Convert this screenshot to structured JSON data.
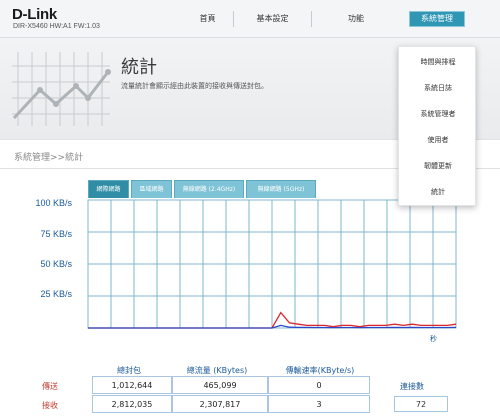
{
  "header": {
    "brand": "D-Link",
    "model": "DIR-X5460 HW:A1 FW:1.03",
    "nav": [
      {
        "label": "首頁"
      },
      {
        "label": "基本設定"
      },
      {
        "label": "功能"
      },
      {
        "label": "系統管理"
      }
    ]
  },
  "banner": {
    "title": "統計",
    "description": "流量統計會顯示經由此裝置的接收與傳送封包。"
  },
  "breadcrumb": "系統管理>>統計",
  "dropdown": {
    "items": [
      {
        "label": "時間與排程"
      },
      {
        "label": "系統日誌"
      },
      {
        "label": "系統管理者"
      },
      {
        "label": "使用者"
      },
      {
        "label": "韌體更新"
      },
      {
        "label": "統計"
      }
    ]
  },
  "tabs": [
    {
      "label": "網際網路"
    },
    {
      "label": "區域網路"
    },
    {
      "label": "無線網路 (2.4GHz)"
    },
    {
      "label": "無線網路 (5GHz)"
    }
  ],
  "chart_data": {
    "type": "line",
    "y_ticks": [
      "100 KB/s",
      "75 KB/s",
      "50 KB/s",
      "25 KB/s"
    ],
    "ylim": [
      0,
      100
    ],
    "x_unit": "秒",
    "grid": true,
    "series": [
      {
        "color": "#d9252b",
        "values": [
          0,
          0,
          0,
          0,
          0,
          0,
          0,
          0,
          0,
          0,
          0,
          0,
          0,
          0,
          0,
          0,
          0,
          0,
          0,
          0,
          0,
          0,
          12,
          4,
          3,
          2,
          2,
          2,
          1,
          2,
          2,
          1,
          2,
          2,
          2,
          3,
          2,
          3,
          2,
          2,
          2,
          2,
          3
        ]
      },
      {
        "color": "#2b48c8",
        "values": [
          0,
          0,
          0,
          0,
          0,
          0,
          0,
          0,
          0,
          0,
          0,
          0,
          0,
          0,
          0,
          0,
          0,
          0,
          0,
          0,
          0,
          0,
          2,
          0.6,
          0.5,
          0.5,
          0.4,
          0.4,
          0.3,
          0.4,
          0.4,
          0.3,
          0.4,
          0.4,
          0.4,
          0.5,
          0.4,
          0.5,
          0.4,
          0.4,
          0.4,
          0.4,
          0.5
        ]
      }
    ]
  },
  "stats": {
    "headers": [
      "總封包",
      "總流量 (KBytes)",
      "傳輸速率(KByte/s)"
    ],
    "rows": [
      {
        "label": "傳送",
        "color": "#c0392b",
        "values": [
          "1,012,644",
          "465,099",
          "0"
        ]
      },
      {
        "label": "接收",
        "color": "#c0392b",
        "values": [
          "2,812,035",
          "2,307,817",
          "3"
        ]
      }
    ],
    "connections_label": "連接數",
    "connections": "72"
  },
  "colors": {
    "accent": "#2f96b4",
    "grid": "#7fb8cc",
    "label_blue": "#1a5a9a"
  }
}
